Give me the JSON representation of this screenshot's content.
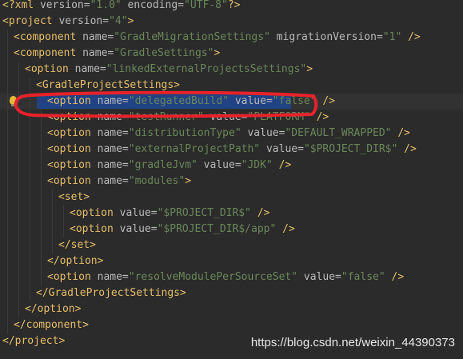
{
  "editor": {
    "language": "xml",
    "current_line": 6,
    "lines": [
      {
        "indent": 0,
        "parts": [
          [
            "tag",
            "<?xml "
          ],
          [
            "attr",
            "version="
          ],
          [
            "val",
            "\"1.0\""
          ],
          [
            "attr",
            " encoding="
          ],
          [
            "val",
            "\"UTF-8\""
          ],
          [
            "tag",
            "?>"
          ]
        ]
      },
      {
        "indent": 0,
        "parts": [
          [
            "tag",
            "<project "
          ],
          [
            "attr",
            "version="
          ],
          [
            "val",
            "\"4\""
          ],
          [
            "tag",
            ">"
          ]
        ]
      },
      {
        "indent": 1,
        "parts": [
          [
            "tag",
            "<component "
          ],
          [
            "attr",
            "name="
          ],
          [
            "val",
            "\"GradleMigrationSettings\""
          ],
          [
            "attr",
            " migrationVersion="
          ],
          [
            "val",
            "\"1\""
          ],
          [
            "tag",
            " />"
          ]
        ]
      },
      {
        "indent": 1,
        "parts": [
          [
            "tag",
            "<component "
          ],
          [
            "attr",
            "name="
          ],
          [
            "val",
            "\"GradleSettings\""
          ],
          [
            "tag",
            ">"
          ]
        ]
      },
      {
        "indent": 2,
        "parts": [
          [
            "tag",
            "<option "
          ],
          [
            "attr",
            "name="
          ],
          [
            "val",
            "\"linkedExternalProjectsSettings\""
          ],
          [
            "tag",
            ">"
          ]
        ]
      },
      {
        "indent": 3,
        "parts": [
          [
            "tag",
            "<GradleProjectSettings>"
          ]
        ]
      },
      {
        "indent": 4,
        "parts": [
          [
            "tag",
            "<option "
          ],
          [
            "attr",
            "name="
          ],
          [
            "val",
            "\"delegatedBuild\""
          ],
          [
            "attr",
            " value="
          ],
          [
            "val",
            "\"false\""
          ],
          [
            "tag",
            " />"
          ]
        ]
      },
      {
        "indent": 4,
        "parts": [
          [
            "tag",
            "<option "
          ],
          [
            "attr",
            "name="
          ],
          [
            "val",
            "\"testRunner\""
          ],
          [
            "attr",
            " value="
          ],
          [
            "val",
            "\"PLATFORM\""
          ],
          [
            "tag",
            " />"
          ]
        ]
      },
      {
        "indent": 4,
        "parts": [
          [
            "tag",
            "<option "
          ],
          [
            "attr",
            "name="
          ],
          [
            "val",
            "\"distributionType\""
          ],
          [
            "attr",
            " value="
          ],
          [
            "val",
            "\"DEFAULT_WRAPPED\""
          ],
          [
            "tag",
            " />"
          ]
        ]
      },
      {
        "indent": 4,
        "parts": [
          [
            "tag",
            "<option "
          ],
          [
            "attr",
            "name="
          ],
          [
            "val",
            "\"externalProjectPath\""
          ],
          [
            "attr",
            " value="
          ],
          [
            "val",
            "\"$PROJECT_DIR$\""
          ],
          [
            "tag",
            " />"
          ]
        ]
      },
      {
        "indent": 4,
        "parts": [
          [
            "tag",
            "<option "
          ],
          [
            "attr",
            "name="
          ],
          [
            "val",
            "\"gradleJvm\""
          ],
          [
            "attr",
            " value="
          ],
          [
            "val",
            "\"JDK\""
          ],
          [
            "tag",
            " />"
          ]
        ]
      },
      {
        "indent": 4,
        "parts": [
          [
            "tag",
            "<option "
          ],
          [
            "attr",
            "name="
          ],
          [
            "val",
            "\"modules\""
          ],
          [
            "tag",
            ">"
          ]
        ]
      },
      {
        "indent": 5,
        "parts": [
          [
            "tag",
            "<set>"
          ]
        ]
      },
      {
        "indent": 6,
        "parts": [
          [
            "tag",
            "<option "
          ],
          [
            "attr",
            "value="
          ],
          [
            "val",
            "\"$PROJECT_DIR$\""
          ],
          [
            "tag",
            " />"
          ]
        ]
      },
      {
        "indent": 6,
        "parts": [
          [
            "tag",
            "<option "
          ],
          [
            "attr",
            "value="
          ],
          [
            "val",
            "\"$PROJECT_DIR$/app\""
          ],
          [
            "tag",
            " />"
          ]
        ]
      },
      {
        "indent": 5,
        "parts": [
          [
            "tag",
            "</set>"
          ]
        ]
      },
      {
        "indent": 4,
        "parts": [
          [
            "tag",
            "</option>"
          ]
        ]
      },
      {
        "indent": 4,
        "parts": [
          [
            "tag",
            "<option "
          ],
          [
            "attr",
            "name="
          ],
          [
            "val",
            "\"resolveModulePerSourceSet\""
          ],
          [
            "attr",
            " value="
          ],
          [
            "val",
            "\"false\""
          ],
          [
            "tag",
            " />"
          ]
        ]
      },
      {
        "indent": 3,
        "parts": [
          [
            "tag",
            "</GradleProjectSettings>"
          ]
        ]
      },
      {
        "indent": 2,
        "parts": [
          [
            "tag",
            "</option>"
          ]
        ]
      },
      {
        "indent": 1,
        "parts": [
          [
            "tag",
            "</component>"
          ]
        ]
      },
      {
        "indent": 0,
        "parts": [
          [
            "tag",
            "</project>"
          ]
        ]
      }
    ]
  },
  "colors": {
    "background": "#2b2b2b",
    "tag": "#e8bf6a",
    "attribute": "#bababa",
    "value": "#6a8759",
    "selection": "#214283",
    "annotation": "#e8222b"
  },
  "icons": {
    "gutter": "intention-bulb-icon"
  },
  "watermark": "https://blog.csdn.net/weixin_44390373"
}
